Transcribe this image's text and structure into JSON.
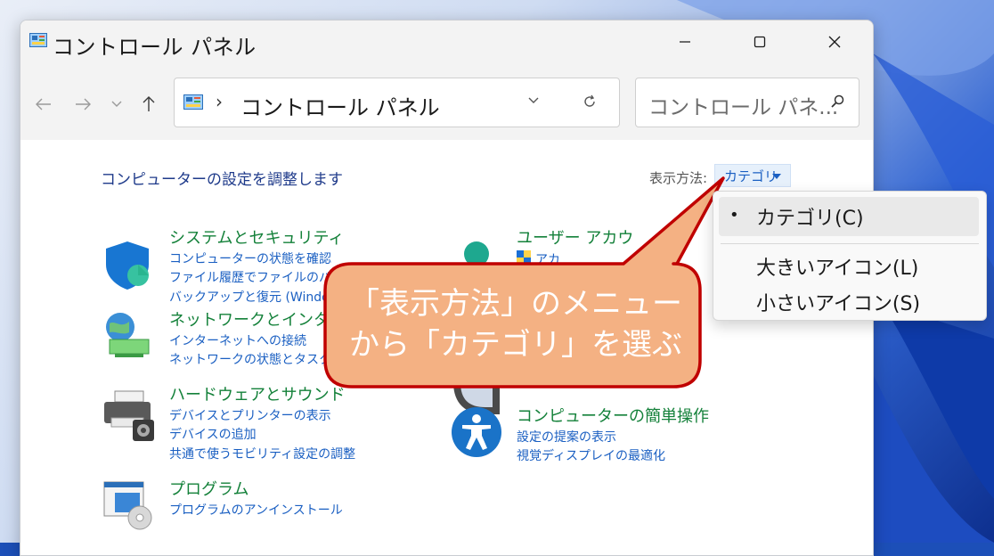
{
  "window": {
    "title": "コントロール パネル",
    "minimize_label": "minimize",
    "maximize_label": "maximize",
    "close_label": "close"
  },
  "address_bar": {
    "separator": "›",
    "path": "コントロール パネル"
  },
  "search": {
    "placeholder": "コントロール パネ..."
  },
  "content": {
    "heading": "コンピューターの設定を調整します",
    "view_by_label": "表示方法:",
    "view_by_value": "カテゴリ"
  },
  "categories": [
    {
      "title": "システムとセキュリティ",
      "links": [
        "コンピューターの状態を確認",
        "ファイル履歴でファイルのバックア",
        "バックアップと復元 (Windows"
      ],
      "icon": "shield-icon"
    },
    {
      "title": "ネットワークとインターネ",
      "links": [
        "インターネットへの接続",
        "ネットワークの状態とタスクの表"
      ],
      "icon": "network-icon"
    },
    {
      "title": "ハードウェアとサウンド",
      "links": [
        "デバイスとプリンターの表示",
        "デバイスの追加",
        "共通で使うモビリティ設定の調整"
      ],
      "icon": "printer-icon"
    },
    {
      "title": "プログラム",
      "links": [
        "プログラムのアンインストール"
      ],
      "icon": "programs-icon"
    },
    {
      "title": "ユーザー アカウ",
      "links": [
        "アカ"
      ],
      "icon": "user-icon"
    },
    {
      "title": "コンピューターの簡単操作",
      "links": [
        "設定の提案の表示",
        "視覚ディスプレイの最適化"
      ],
      "icon": "accessibility-icon"
    }
  ],
  "view_menu": {
    "bullet": "•",
    "items": [
      "カテゴリ(C)",
      "大きいアイコン(L)",
      "小さいアイコン(S)"
    ]
  },
  "callout": {
    "line1": "「表示方法」のメニュー",
    "line2": "から「カテゴリ」を選ぶ"
  },
  "colors": {
    "category_title": "#14813a",
    "link": "#1a5fc2",
    "callout_fill": "#f4b183",
    "callout_border": "#c00000"
  }
}
